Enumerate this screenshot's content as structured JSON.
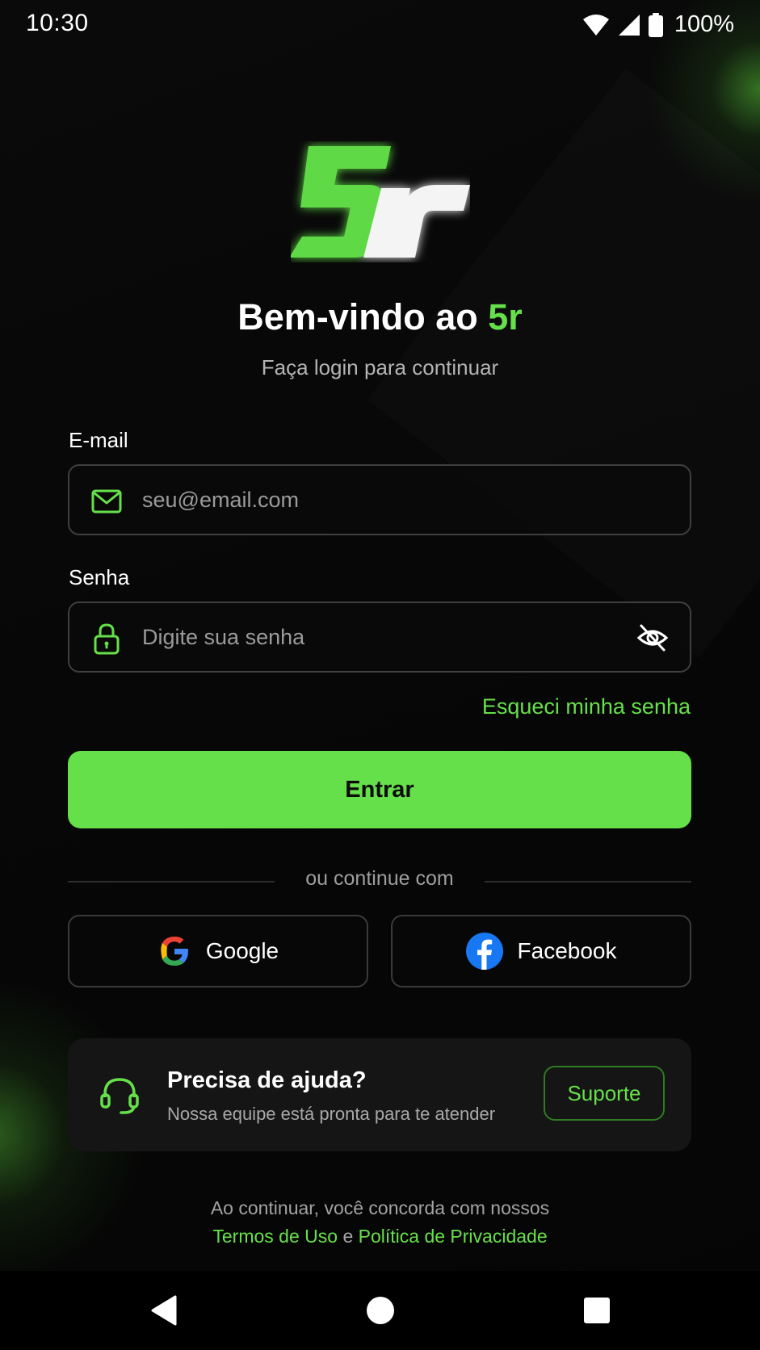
{
  "status_bar": {
    "time": "10:30",
    "battery": "100%",
    "icons": [
      "wifi-icon",
      "cellular-signal-icon",
      "battery-icon"
    ]
  },
  "brand": {
    "logo_text": "5r",
    "accent_color": "#66e04a"
  },
  "header": {
    "title_prefix": "Bem-vindo ao ",
    "title_brand": "5r",
    "subtitle": "Faça login para continuar"
  },
  "form": {
    "email": {
      "label": "E-mail",
      "placeholder": "seu@email.com",
      "value": "",
      "icon": "mail-icon"
    },
    "password": {
      "label": "Senha",
      "placeholder": "Digite sua senha",
      "value": "",
      "icon": "lock-icon",
      "toggle_icon": "eye-off-icon"
    },
    "forgot_password": "Esqueci minha senha",
    "submit_label": "Entrar"
  },
  "social": {
    "divider_text": "ou continue com",
    "google_label": "Google",
    "facebook_label": "Facebook"
  },
  "help": {
    "title": "Precisa de ajuda?",
    "text": "Nossa equipe está pronta para te atender",
    "button_label": "Suporte",
    "icon": "headset-icon"
  },
  "terms": {
    "line1": "Ao continuar, você concorda com nossos",
    "terms_link": "Termos de Uso",
    "conjunction": " e ",
    "privacy_link": "Política de Privacidade"
  },
  "nav": {
    "buttons": [
      "back-icon",
      "home-icon",
      "recents-icon"
    ]
  }
}
